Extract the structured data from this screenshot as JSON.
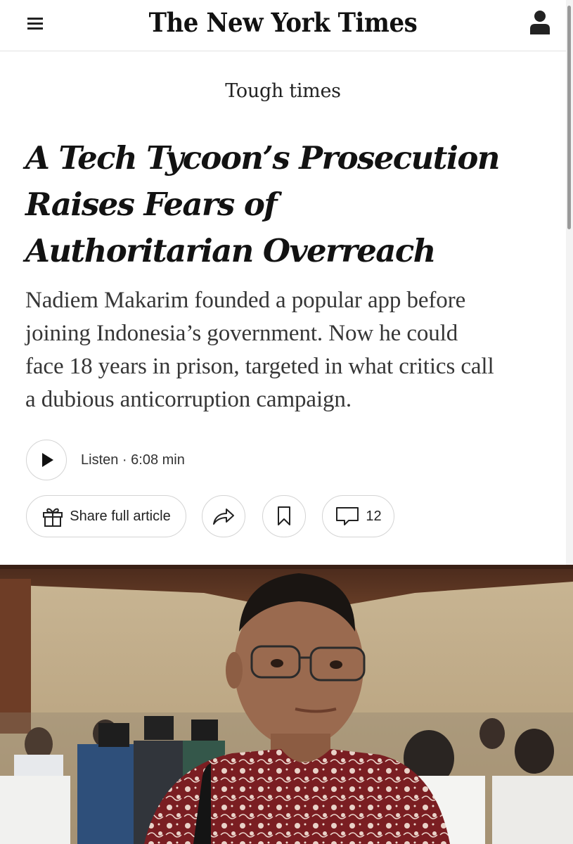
{
  "header": {
    "logo_text": "The New York Times",
    "menu_icon": "hamburger-menu-icon",
    "account_icon": "user-account-icon"
  },
  "article": {
    "kicker": "Tough times",
    "headline_lines": [
      "A Tech Tycoon’s Prosecution",
      "Raises Fears of",
      "Authoritarian Overreach"
    ],
    "summary_lines": [
      "Nadiem Makarim founded a popular app before",
      "joining Indonesia’s government. Now he could",
      "face 18 years in prison, targeted in what critics call",
      "a dubious anticorruption campaign."
    ]
  },
  "listen": {
    "label": "Listen · 6:08 min",
    "icon": "play-icon"
  },
  "actions": {
    "share_full_label": "Share full article",
    "share_full_icon": "gift-icon",
    "share_icon": "share-arrow-icon",
    "save_icon": "bookmark-icon",
    "comments_icon": "comment-icon",
    "comments_count": "12"
  },
  "colors": {
    "text": "#121212",
    "summary_text": "#363636",
    "border": "#d4d4d4",
    "background": "#ffffff"
  }
}
